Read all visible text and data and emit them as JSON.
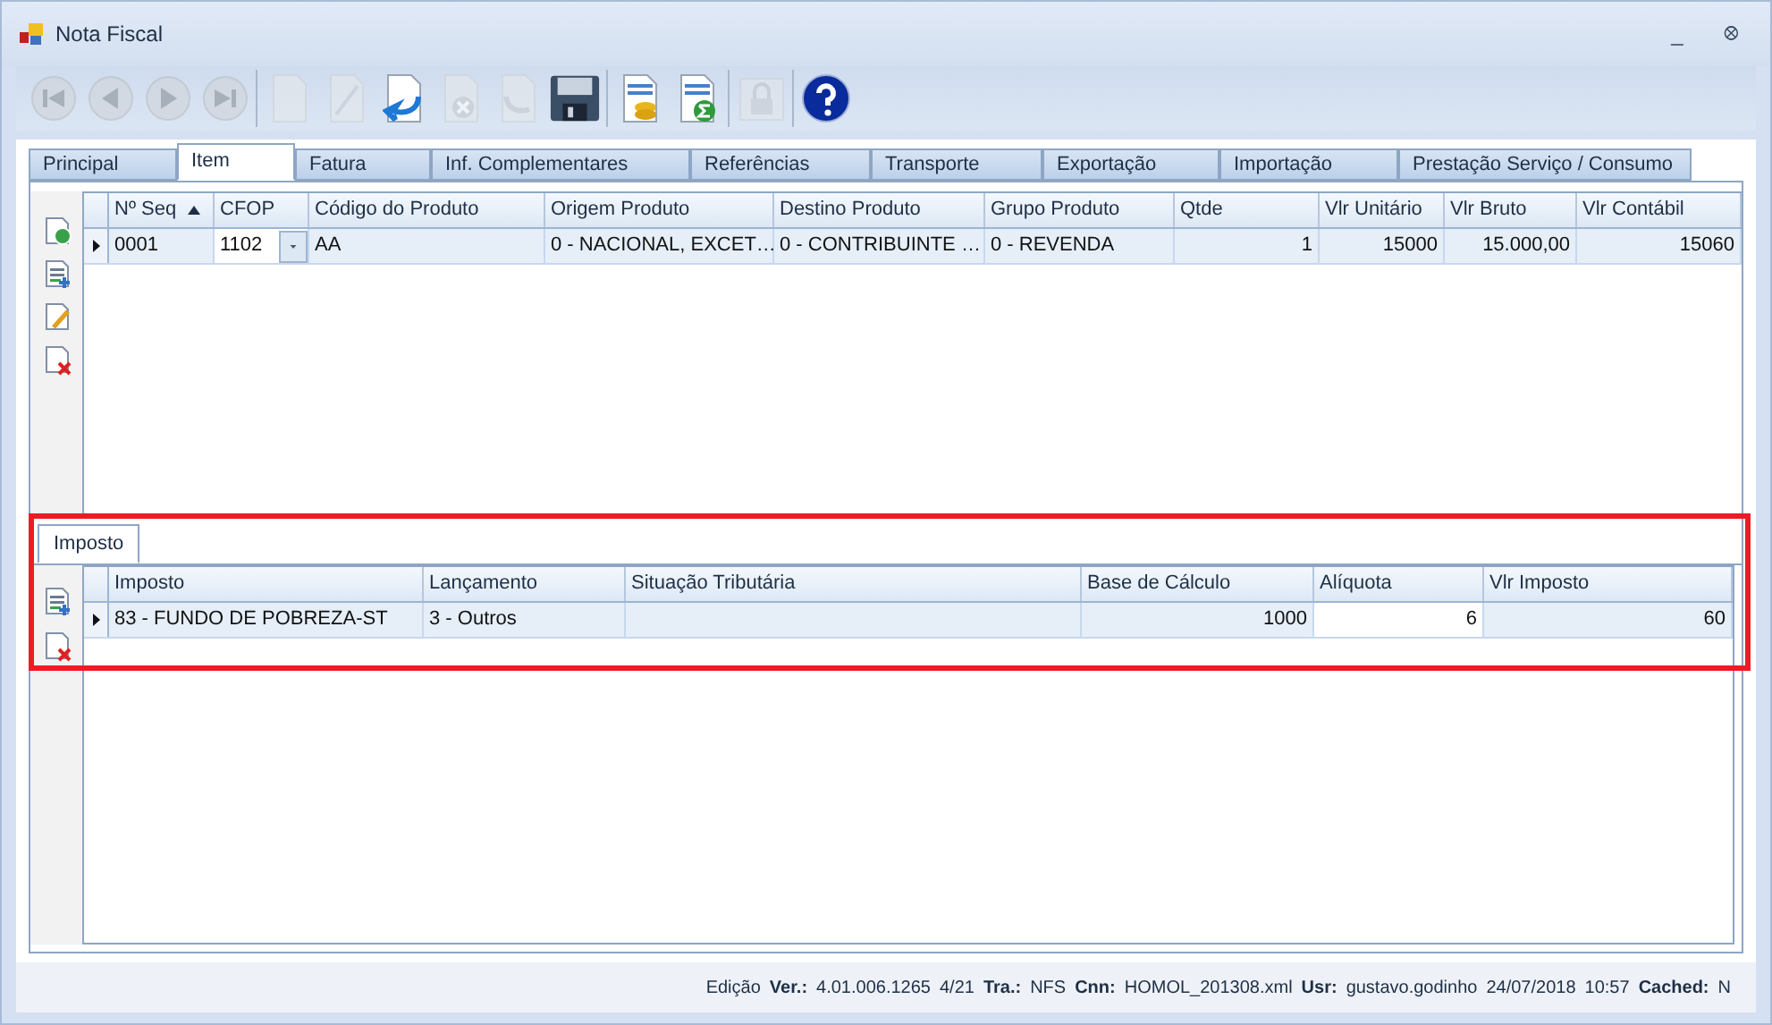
{
  "window": {
    "title": "Nota Fiscal",
    "buttons": [
      "_",
      "ꕕ"
    ]
  },
  "toolbar": [
    [
      {
        "kind": "first",
        "disabled": true
      },
      {
        "kind": "prev",
        "disabled": true
      },
      {
        "kind": "next",
        "disabled": true
      },
      {
        "kind": "last",
        "disabled": true
      }
    ],
    [
      {
        "kind": "new",
        "disabled": true
      },
      {
        "kind": "edit",
        "disabled": true
      },
      {
        "kind": "undo",
        "disabled": false
      },
      {
        "kind": "cancel",
        "disabled": true
      },
      {
        "kind": "redo",
        "disabled": true
      },
      {
        "kind": "save",
        "disabled": false
      }
    ],
    [
      {
        "kind": "report-coins",
        "disabled": false
      },
      {
        "kind": "report-sum",
        "disabled": false
      }
    ],
    [
      {
        "kind": "lock",
        "disabled": true
      }
    ],
    [
      {
        "kind": "help",
        "disabled": false
      }
    ]
  ],
  "tabs": [
    {
      "label": "Principal",
      "selected": false
    },
    {
      "label": "Item",
      "selected": true
    },
    {
      "label": "Fatura",
      "selected": false
    },
    {
      "label": "Inf. Complementares",
      "selected": false
    },
    {
      "label": "Referências",
      "selected": false
    },
    {
      "label": "Transporte",
      "selected": false
    },
    {
      "label": "Exportação",
      "selected": false
    },
    {
      "label": "Importação",
      "selected": false
    },
    {
      "label": "Prestação Serviço / Consumo",
      "selected": false
    }
  ],
  "items_table": {
    "columns": [
      {
        "label": "Nº Seq",
        "sorted": true,
        "numeric": false
      },
      {
        "label": "CFOP",
        "sorted": false,
        "numeric": false
      },
      {
        "label": "Código do Produto",
        "sorted": false,
        "numeric": false
      },
      {
        "label": "Origem Produto",
        "sorted": false,
        "numeric": false
      },
      {
        "label": "Destino Produto",
        "sorted": false,
        "numeric": false
      },
      {
        "label": "Grupo Produto",
        "sorted": false,
        "numeric": false
      },
      {
        "label": "Qtde",
        "sorted": false,
        "numeric": true
      },
      {
        "label": "Vlr Unitário",
        "sorted": false,
        "numeric": true
      },
      {
        "label": "Vlr Bruto",
        "sorted": false,
        "numeric": true
      },
      {
        "label": "Vlr Contábil",
        "sorted": false,
        "numeric": true
      }
    ],
    "rows": [
      {
        "current": true,
        "cells": [
          {
            "text": "0001",
            "kind": "text"
          },
          {
            "text": "1102",
            "kind": "combo"
          },
          {
            "text": "AA",
            "kind": "text"
          },
          {
            "text": "0 - NACIONAL, EXCET…",
            "kind": "text"
          },
          {
            "text": "0 - CONTRIBUINTE …",
            "kind": "text"
          },
          {
            "text": "0 - REVENDA",
            "kind": "text"
          },
          {
            "text": "1",
            "kind": "text"
          },
          {
            "text": "15000",
            "kind": "text"
          },
          {
            "text": "15.000,00",
            "kind": "text"
          },
          {
            "text": "15060",
            "kind": "text"
          }
        ]
      }
    ]
  },
  "sub_tabs": [
    {
      "label": "Imposto",
      "selected": true
    }
  ],
  "tax_table": {
    "columns": [
      {
        "label": "Imposto",
        "numeric": false
      },
      {
        "label": "Lançamento",
        "numeric": false
      },
      {
        "label": "Situação Tributária",
        "numeric": false
      },
      {
        "label": "Base de Cálculo",
        "numeric": true
      },
      {
        "label": "Alíquota",
        "numeric": true
      },
      {
        "label": "Vlr Imposto",
        "numeric": true
      }
    ],
    "rows": [
      {
        "current": true,
        "cells": [
          {
            "text": "83 - FUNDO DE POBREZA-ST",
            "kind": "text"
          },
          {
            "text": "3 - Outros",
            "kind": "text"
          },
          {
            "kind": "text"
          },
          {
            "text": "1000",
            "kind": "text"
          },
          {
            "text": "6",
            "kind": "editing"
          },
          {
            "text": "60",
            "kind": "text"
          }
        ]
      }
    ]
  },
  "status_bar": [
    {
      "kind": "plain",
      "text": "Edição"
    },
    {
      "kind": "field",
      "label": "Ver.:",
      "value": "4.01.006.1265"
    },
    {
      "kind": "plain",
      "text": "4/21"
    },
    {
      "kind": "field",
      "label": "Tra.:",
      "value": "NFS"
    },
    {
      "kind": "field",
      "label": "Cnn:",
      "value": "HOMOL_201308.xml"
    },
    {
      "kind": "field",
      "label": "Usr:",
      "value": "gustavo.godinho"
    },
    {
      "kind": "plain",
      "text": "24/07/2018"
    },
    {
      "kind": "plain",
      "text": "10:57"
    },
    {
      "kind": "field",
      "label": "Cached:",
      "value": "N"
    }
  ]
}
